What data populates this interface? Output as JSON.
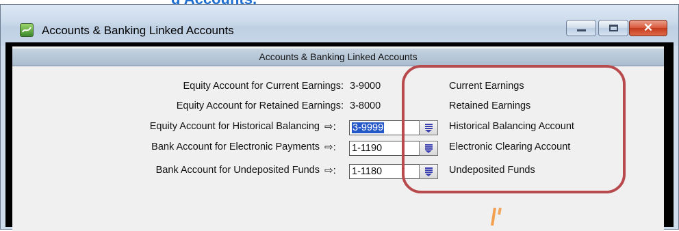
{
  "top_fragment": "g Accounts,",
  "window": {
    "title": "Accounts & Banking Linked Accounts",
    "icon": "app-icon",
    "buttons": {
      "minimize": "minimize-button",
      "maximize": "maximize-button",
      "close": "close-button"
    },
    "close_glyph": "✕"
  },
  "section": {
    "header": "Accounts & Banking Linked Accounts"
  },
  "rows": [
    {
      "label": "Equity Account for Current Earnings:",
      "value": "3-9000",
      "description": "Current Earnings",
      "editable": false
    },
    {
      "label": "Equity Account for Retained Earnings:",
      "value": "3-8000",
      "description": "Retained Earnings",
      "editable": false
    },
    {
      "label": "Equity Account for Historical Balancing",
      "arrow": "⇨:",
      "value": "3-9999",
      "description": "Historical Balancing Account",
      "editable": true,
      "selected": true
    },
    {
      "label": "Bank Account for Electronic Payments",
      "arrow": "⇨:",
      "value": "1-1190",
      "description": "Electronic Clearing Account",
      "editable": true
    },
    {
      "label": "Bank Account for Undeposited Funds",
      "arrow": "⇨:",
      "value": "1-1180",
      "description": "Undeposited Funds",
      "editable": true
    }
  ],
  "annotation_color": "#b84a4e",
  "arrow_color": "#f0a050"
}
